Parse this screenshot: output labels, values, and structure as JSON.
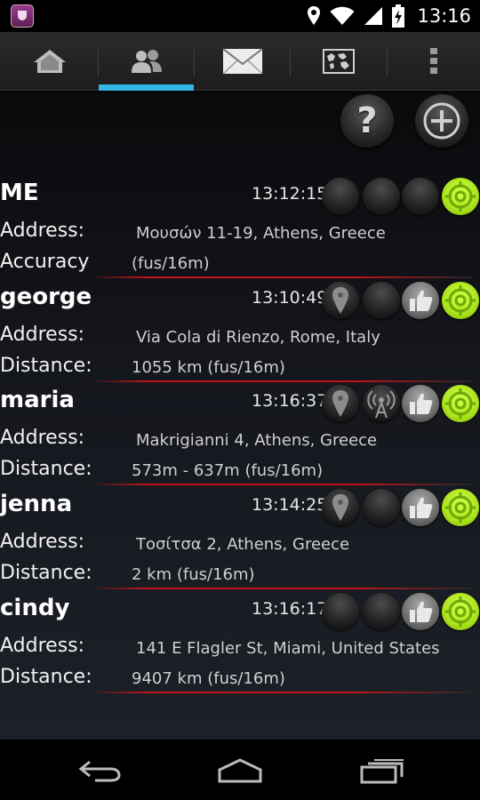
{
  "status_bar": {
    "app_icon": "shield-app-icon",
    "icons": [
      "location-icon",
      "wifi-icon",
      "signal-icon",
      "battery-charging-icon"
    ],
    "time": "13:16"
  },
  "tabs": [
    {
      "name": "home",
      "icon": "home-icon",
      "selected": false
    },
    {
      "name": "friends",
      "icon": "people-icon",
      "selected": true
    },
    {
      "name": "messages",
      "icon": "envelope-icon",
      "selected": false
    },
    {
      "name": "map",
      "icon": "map-icon",
      "selected": false
    },
    {
      "name": "more",
      "icon": "overflow-menu-icon",
      "selected": false
    }
  ],
  "colors": {
    "accent": "#33b5e5",
    "separator": "#c0141a",
    "active_indicator": "#a9e31a"
  },
  "actions": {
    "help_icon": "help-icon",
    "help_label": "?",
    "add_icon": "add-icon"
  },
  "entries": [
    {
      "name": "ME",
      "time": "13:12:15",
      "indicators": [
        "dark",
        "dark",
        "dark",
        "target"
      ],
      "address_label": "Address:",
      "address": "Μουσών 11-19, Athens, Greece",
      "detail_label": "Accuracy",
      "detail": "(fus/16m)"
    },
    {
      "name": "george",
      "time": "13:10:49",
      "indicators": [
        "pin",
        "dark",
        "thumb",
        "target"
      ],
      "address_label": "Address:",
      "address": "Via Cola di Rienzo, Rome, Italy",
      "detail_label": "Distance:",
      "detail": "1055 km (fus/16m)"
    },
    {
      "name": "maria",
      "time": "13:16:37",
      "indicators": [
        "pin",
        "antenna",
        "thumb",
        "target"
      ],
      "address_label": "Address:",
      "address": "Makrigianni 4, Athens, Greece",
      "detail_label": "Distance:",
      "detail": "573m - 637m (fus/16m)"
    },
    {
      "name": "jenna",
      "time": "13:14:25",
      "indicators": [
        "pin",
        "dark",
        "thumb",
        "target"
      ],
      "address_label": "Address:",
      "address": "Τοσίτσα 2, Athens, Greece",
      "detail_label": "Distance:",
      "detail": "2 km (fus/16m)"
    },
    {
      "name": "cindy",
      "time": "13:16:17",
      "indicators": [
        "dark",
        "dark",
        "thumb",
        "target"
      ],
      "address_label": "Address:",
      "address": "141 E Flagler St, Miami, United States",
      "detail_label": "Distance:",
      "detail": "9407 km (fus/16m)"
    }
  ],
  "nav_bar": {
    "back_icon": "back-icon",
    "home_icon": "home-nav-icon",
    "recents_icon": "recent-apps-icon"
  }
}
